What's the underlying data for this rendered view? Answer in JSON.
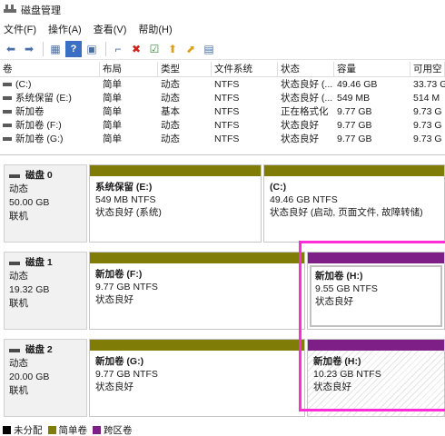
{
  "window": {
    "title": "磁盘管理"
  },
  "menu": [
    {
      "label": "文件(F)"
    },
    {
      "label": "操作(A)"
    },
    {
      "label": "查看(V)"
    },
    {
      "label": "帮助(H)"
    }
  ],
  "toolbar": {
    "icons": [
      "back-icon",
      "forward-icon",
      "properties-icon",
      "help-icon",
      "console-icon",
      "connect-icon",
      "delete-icon",
      "check-icon",
      "open-icon",
      "explore-icon",
      "list-icon"
    ],
    "glyphs": [
      "⬅",
      "➡",
      "▦",
      "?",
      "▣",
      "⌐",
      "✖",
      "☑",
      "⬆",
      "⬈",
      "▤"
    ]
  },
  "volume_table": {
    "columns": [
      "卷",
      "布局",
      "类型",
      "文件系统",
      "状态",
      "容量",
      "可用空"
    ],
    "rows": [
      [
        "(C:)",
        "简单",
        "动态",
        "NTFS",
        "状态良好 (...",
        "49.46 GB",
        "33.73 G"
      ],
      [
        "系统保留 (E:)",
        "简单",
        "动态",
        "NTFS",
        "状态良好 (...",
        "549 MB",
        "514 M"
      ],
      [
        "新加卷",
        "简单",
        "基本",
        "NTFS",
        "正在格式化",
        "9.77 GB",
        "9.73 G"
      ],
      [
        "新加卷 (F:)",
        "简单",
        "动态",
        "NTFS",
        "状态良好",
        "9.77 GB",
        "9.73 G"
      ],
      [
        "新加卷 (G:)",
        "简单",
        "动态",
        "NTFS",
        "状态良好",
        "9.77 GB",
        "9.73 G"
      ]
    ]
  },
  "disks": [
    {
      "name": "磁盘 0",
      "type": "动态",
      "size": "50.00 GB",
      "status": "联机",
      "partitions": [
        {
          "name": "系统保留  (E:)",
          "detail": "549 MB NTFS",
          "status": "状态良好 (系统)",
          "kind": "simple"
        },
        {
          "name": "(C:)",
          "detail": "49.46 GB NTFS",
          "status": "状态良好 (启动, 页面文件, 故障转储)",
          "kind": "simple"
        }
      ]
    },
    {
      "name": "磁盘 1",
      "type": "动态",
      "size": "19.32 GB",
      "status": "联机",
      "partitions": [
        {
          "name": "新加卷  (F:)",
          "detail": "9.77 GB NTFS",
          "status": "状态良好",
          "kind": "simple"
        },
        {
          "name": "新加卷  (H:)",
          "detail": "9.55 GB NTFS",
          "status": "状态良好",
          "kind": "spanned"
        }
      ]
    },
    {
      "name": "磁盘 2",
      "type": "动态",
      "size": "20.00 GB",
      "status": "联机",
      "partitions": [
        {
          "name": "新加卷  (G:)",
          "detail": "9.77 GB NTFS",
          "status": "状态良好",
          "kind": "simple"
        },
        {
          "name": "新加卷  (H:)",
          "detail": "10.23 GB NTFS",
          "status": "状态良好",
          "kind": "spanned"
        }
      ]
    }
  ],
  "legend": [
    {
      "label": "未分配",
      "color": "#000000"
    },
    {
      "label": "简单卷",
      "color": "#7f7c08"
    },
    {
      "label": "跨区卷",
      "color": "#7d1f87"
    }
  ],
  "colors": {
    "simple": "#7f7c08",
    "spanned": "#7d1f87",
    "highlight": "#ff2cd8"
  }
}
